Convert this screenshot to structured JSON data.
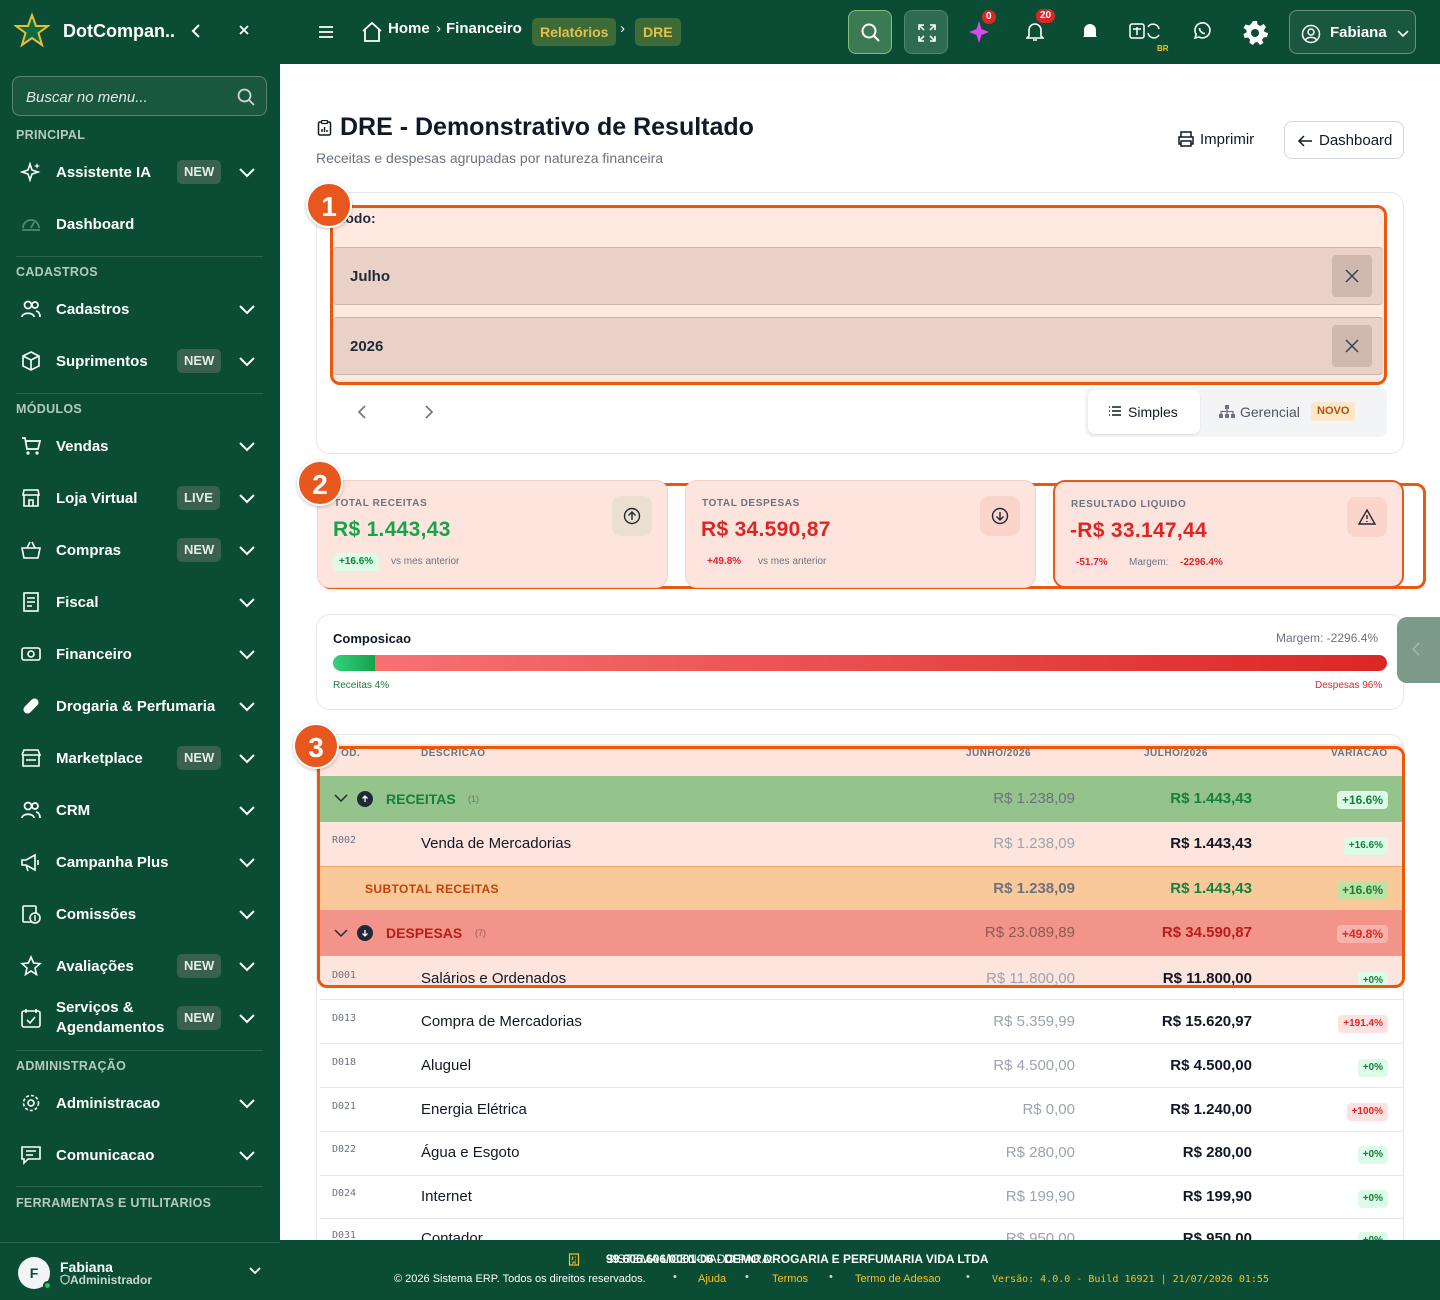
{
  "sidebar": {
    "brand": "DotCompan...",
    "search_placeholder": "Buscar no menu...",
    "sections": {
      "principal": "PRINCIPAL",
      "cadastros": "CADASTROS",
      "modulos": "MÓDULOS",
      "administracao": "ADMINISTRAÇÃO",
      "ferramentas": "FERRAMENTAS E UTILITARIOS"
    },
    "items": [
      {
        "label": "Assistente IA",
        "badge": "NEW",
        "icon": "sparkle-icon"
      },
      {
        "label": "Dashboard",
        "badge": "",
        "icon": "gauge-icon"
      },
      {
        "label": "Cadastros",
        "badge": "",
        "icon": "users-icon"
      },
      {
        "label": "Suprimentos",
        "badge": "NEW",
        "icon": "box-icon"
      },
      {
        "label": "Vendas",
        "badge": "",
        "icon": "cart-icon"
      },
      {
        "label": "Loja Virtual",
        "badge": "LIVE",
        "icon": "store-icon"
      },
      {
        "label": "Compras",
        "badge": "NEW",
        "icon": "basket-icon"
      },
      {
        "label": "Fiscal",
        "badge": "",
        "icon": "receipt-icon"
      },
      {
        "label": "Financeiro",
        "badge": "",
        "icon": "cash-icon"
      },
      {
        "label": "Drogaria & Perfumaria",
        "badge": "",
        "icon": "pill-icon"
      },
      {
        "label": "Marketplace",
        "badge": "NEW",
        "icon": "shop-icon"
      },
      {
        "label": "CRM",
        "badge": "",
        "icon": "users-icon"
      },
      {
        "label": "Campanha Plus",
        "badge": "",
        "icon": "megaphone-icon"
      },
      {
        "label": "Comissões",
        "badge": "",
        "icon": "commission-icon"
      },
      {
        "label": "Avaliações",
        "badge": "NEW",
        "icon": "star-icon"
      },
      {
        "label": "Serviços & Agendamentos",
        "badge": "NEW",
        "icon": "calendar-icon"
      },
      {
        "label": "Administracao",
        "badge": "",
        "icon": "gear-icon"
      },
      {
        "label": "Comunicacao",
        "badge": "",
        "icon": "chat-icon"
      }
    ],
    "user": {
      "initial": "F",
      "name": "Fabiana",
      "role": "Administrador"
    }
  },
  "topbar": {
    "breadcrumb": [
      "Home",
      "Financeiro",
      "Relatórios",
      "DRE"
    ],
    "ai_badge": "0",
    "notifications_badge": "20",
    "lang": "BR",
    "user_name": "Fabiana"
  },
  "page": {
    "title": "DRE - Demonstrativo de Resultado",
    "subtitle": "Receitas e despesas agrupadas por natureza financeira",
    "print_label": "Imprimir",
    "dashboard_label": "Dashboard"
  },
  "filters": {
    "period_label": "ríodo:",
    "month": "Julho",
    "year": "2026",
    "view_simple": "Simples",
    "view_managerial": "Gerencial",
    "new_badge": "NOVO"
  },
  "markers": [
    "1",
    "2",
    "3"
  ],
  "kpis": [
    {
      "title": "TOTAL RECEITAS",
      "value": "R$ 1.443,43",
      "pct": "+16.6%",
      "sub": "vs mes anterior",
      "color": "#16a34a"
    },
    {
      "title": "TOTAL DESPESAS",
      "value": "R$ 34.590,87",
      "pct": "+49.8%",
      "sub": "vs mes anterior",
      "color": "#dc2626"
    },
    {
      "title": "RESULTADO LIQUIDO",
      "value": "-R$ 33.147,44",
      "pct": "-51.7%",
      "sub": "Margem:",
      "margin": "-2296.4%",
      "color": "#dc2626"
    }
  ],
  "composition": {
    "title": "Composicao",
    "margin": "Margem: -2296.4%",
    "revenue_label": "Receitas 4%",
    "expense_label": "Despesas 96%",
    "revenue_pct": 4,
    "expense_pct": 96
  },
  "table": {
    "headers": {
      "code": "OD.",
      "desc": "DESCRICAO",
      "prev": "JUNHO/2026",
      "curr": "JULHO/2026",
      "var": "VARIACAO"
    },
    "revenue_group": {
      "label": "RECEITAS",
      "count": "(1)",
      "prev": "R$ 1.238,09",
      "curr": "R$ 1.443,43",
      "var": "+16.6%"
    },
    "revenue_rows": [
      {
        "code": "R002",
        "desc": "Venda de Mercadorias",
        "prev": "R$ 1.238,09",
        "curr": "R$ 1.443,43",
        "var": "+16.6%"
      }
    ],
    "subtotal": {
      "label": "SUBTOTAL RECEITAS",
      "prev": "R$ 1.238,09",
      "curr": "R$ 1.443,43",
      "var": "+16.6%"
    },
    "expense_group": {
      "label": "DESPESAS",
      "count": "(7)",
      "prev": "R$ 23.089,89",
      "curr": "R$ 34.590,87",
      "var": "+49.8%"
    },
    "expense_rows": [
      {
        "code": "D001",
        "desc": "Salários e Ordenados",
        "prev": "R$ 11.800,00",
        "curr": "R$ 11.800,00",
        "var": "+0%"
      },
      {
        "code": "D013",
        "desc": "Compra de Mercadorias",
        "prev": "R$ 5.359,99",
        "curr": "R$ 15.620,97",
        "var": "+191.4%"
      },
      {
        "code": "D018",
        "desc": "Aluguel",
        "prev": "R$ 4.500,00",
        "curr": "R$ 4.500,00",
        "var": "+0%"
      },
      {
        "code": "D021",
        "desc": "Energia Elétrica",
        "prev": "R$ 0,00",
        "curr": "R$ 1.240,00",
        "var": "+100%"
      },
      {
        "code": "D022",
        "desc": "Água e Esgoto",
        "prev": "R$ 280,00",
        "curr": "R$ 280,00",
        "var": "+0%"
      },
      {
        "code": "D024",
        "desc": "Internet",
        "prev": "R$ 199,90",
        "curr": "R$ 199,90",
        "var": "+0%"
      },
      {
        "code": "D031",
        "desc": "Contador",
        "prev": "R$ 950,00",
        "curr": "R$ 950,00",
        "var": "+0%"
      }
    ]
  },
  "footer": {
    "license_prefix": "SISTEMA LICENCIADO PARA:",
    "license_value": "99.606.606/0001-06 - DEMO DROGARIA E PERFUMARIA VIDA LTDA",
    "copyright": "© 2026 Sistema ERP. Todos os direitos reservados.",
    "help": "Ajuda",
    "terms": "Termos",
    "adhesion": "Termo de Adesao",
    "version": "Versão: 4.0.0 - Build 16921 | 21/07/2026 01:55"
  }
}
